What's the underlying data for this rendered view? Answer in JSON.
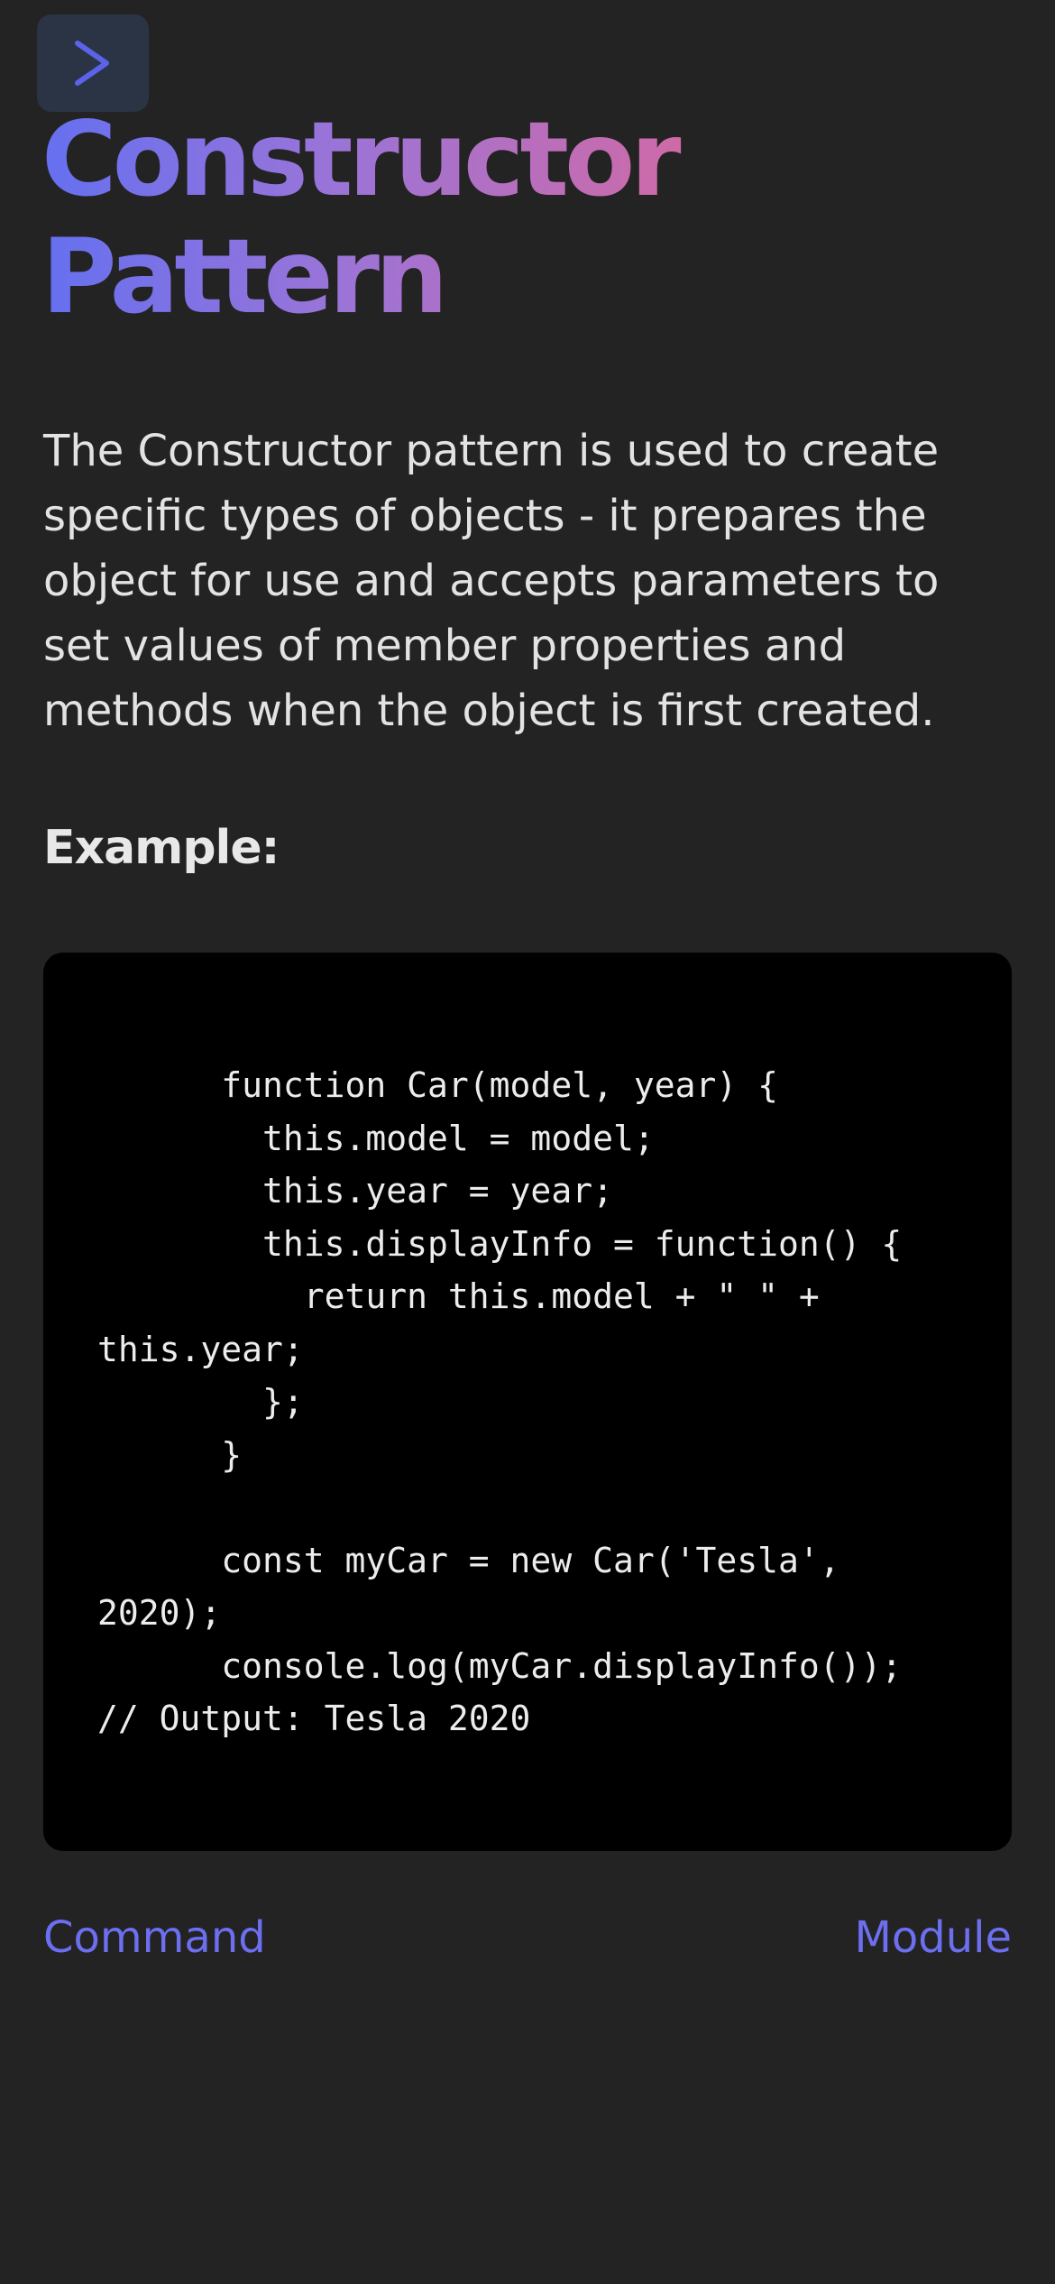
{
  "header": {
    "menu_icon": "chevron-right-icon",
    "title_line1": "Constructor",
    "title_line2": "Pattern",
    "title_gradient": [
      "#6570f0",
      "#9a74d8",
      "#d06aa6"
    ]
  },
  "content": {
    "description": "The Constructor pattern is used to create specific types of objects - it prepares the object for use and accepts parameters to set values of member properties and methods when the object is first created.",
    "example_heading": "Example:",
    "code": "      function Car(model, year) {\n        this.model = model;\n        this.year = year;\n        this.displayInfo = function() {\n          return this.model + \" \" +\nthis.year;\n        };\n      }\n\n      const myCar = new Car('Tesla',\n2020);\n      console.log(myCar.displayInfo());\n// Output: Tesla 2020"
  },
  "navigation": {
    "prev_label": "Command",
    "next_label": "Module"
  },
  "colors": {
    "background": "#232323",
    "code_background": "#000000",
    "link": "#6b6ff0",
    "menu_button": "#2b3445",
    "menu_icon": "#5b63e8"
  }
}
